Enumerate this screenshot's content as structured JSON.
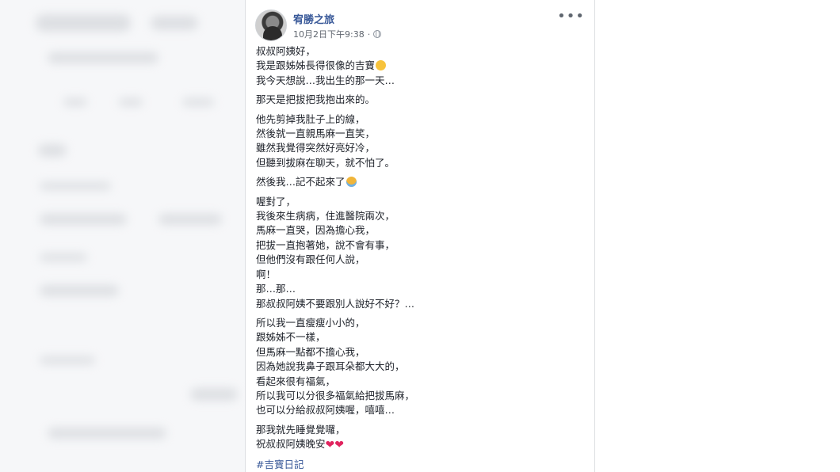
{
  "post": {
    "author": "宥勝之旅",
    "timestamp": "10月2日下午9:38",
    "separator": "·",
    "paragraphs": [
      [
        "叔叔阿姨好，",
        "我是跟姊姊長得很像的吉寶",
        "我今天想說…我出生的那一天…"
      ],
      [
        "那天是把拔把我抱出來的。"
      ],
      [
        "他先剪掉我肚子上的線，",
        "然後就一直親馬麻一直笑，",
        "雖然我覺得突然好亮好冷，",
        "但聽到拔麻在聊天，就不怕了。"
      ],
      [
        "然後我…記不起來了"
      ],
      [
        "喔對了，",
        "我後來生病病，住進醫院兩次，",
        "馬麻一直哭，因為擔心我，",
        "把拔一直抱著她，說不會有事，",
        "但他們沒有跟任何人說，",
        "啊！",
        "那…那…",
        "那叔叔阿姨不要跟別人說好不好？…"
      ],
      [
        "所以我一直瘦瘦小小的，",
        "跟姊姊不一樣，",
        "但馬麻一點都不擔心我，",
        "因為她說我鼻子跟耳朵都大大的，",
        "看起來很有福氣，",
        "所以我可以分很多福氣給把拔馬麻，",
        "也可以分給叔叔阿姨喔，嘻嘻…"
      ],
      [
        "那我就先睡覺覺囉，",
        "祝叔叔阿姨晚安"
      ]
    ],
    "hashtag": "#吉寶日記",
    "icons": {
      "more": "more-options-icon",
      "privacy": "globe-icon",
      "smile": "smiling-face-emoji",
      "sad": "sad-face-emoji",
      "heart": "heart-emoji"
    }
  }
}
